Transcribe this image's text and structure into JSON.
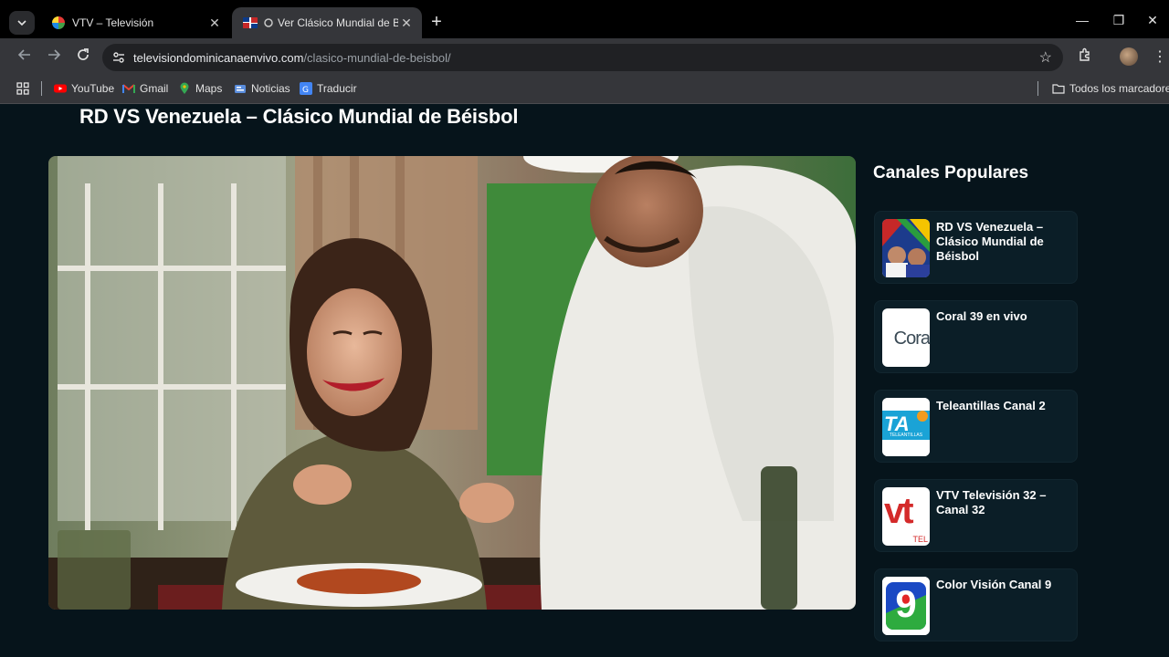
{
  "browser": {
    "tabs": [
      {
        "title": "VTV – Televisión",
        "active": false
      },
      {
        "title": "Ver Clásico Mundial de Béisbol",
        "active": true
      }
    ],
    "url_host": "televisiondominicanaenvivo.com",
    "url_path": "/clasico-mundial-de-beisbol/",
    "bookmarks": [
      "YouTube",
      "Gmail",
      "Maps",
      "Noticias",
      "Traducir"
    ],
    "all_bookmarks_label": "Todos los marcadores"
  },
  "page": {
    "title": "RD VS Venezuela – Clásico Mundial de Béisbol"
  },
  "sidebar": {
    "title": "Canales Populares",
    "channels": [
      {
        "name": "RD VS Venezuela – Clásico Mundial de Béisbol",
        "icon": "baseball-thumbnail"
      },
      {
        "name": "Coral 39 en vivo",
        "icon": "coral-logo",
        "logo_text": "Cora"
      },
      {
        "name": "Teleantillas Canal 2",
        "icon": "teleantillas-logo",
        "logo_text": "TA",
        "logo_subtext": "TELEANTILLAS"
      },
      {
        "name": "VTV Televisión 32 – Canal 32",
        "icon": "vtv-logo",
        "logo_text": "vt",
        "logo_subtext": "TEL"
      },
      {
        "name": "Color Visión Canal 9",
        "icon": "color-vision-logo",
        "logo_text": "9"
      }
    ]
  },
  "colors": {
    "page_bg": "#06141b",
    "card_bg": "#0b1e27",
    "tab_active": "#35363a"
  }
}
